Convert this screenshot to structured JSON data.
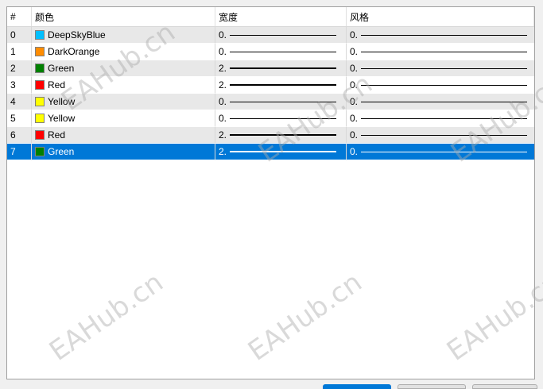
{
  "table": {
    "headers": [
      "#",
      "颜色",
      "宽度",
      "风格"
    ],
    "rows": [
      {
        "index": "0",
        "color_name": "DeepSkyBlue",
        "swatch": "#00bfff",
        "width": "0.",
        "style": "0."
      },
      {
        "index": "1",
        "color_name": "DarkOrange",
        "swatch": "#ff8c00",
        "width": "0.",
        "style": "0."
      },
      {
        "index": "2",
        "color_name": "Green",
        "swatch": "#008000",
        "width": "2.",
        "style": "0."
      },
      {
        "index": "3",
        "color_name": "Red",
        "swatch": "#ff0000",
        "width": "2.",
        "style": "0."
      },
      {
        "index": "4",
        "color_name": "Yellow",
        "swatch": "#ffff00",
        "width": "0.",
        "style": "0."
      },
      {
        "index": "5",
        "color_name": "Yellow",
        "swatch": "#ffff00",
        "width": "0.",
        "style": "0."
      },
      {
        "index": "6",
        "color_name": "Red",
        "swatch": "#ff0000",
        "width": "2.",
        "style": "0."
      },
      {
        "index": "7",
        "color_name": "Green",
        "swatch": "#008000",
        "width": "2.",
        "style": "0."
      }
    ],
    "selected_index": 7
  },
  "watermark": "EAHub.cn",
  "colors": {
    "selection": "#0078d7",
    "alt_row": "#e8e8e8",
    "border": "#a0a0a0"
  }
}
